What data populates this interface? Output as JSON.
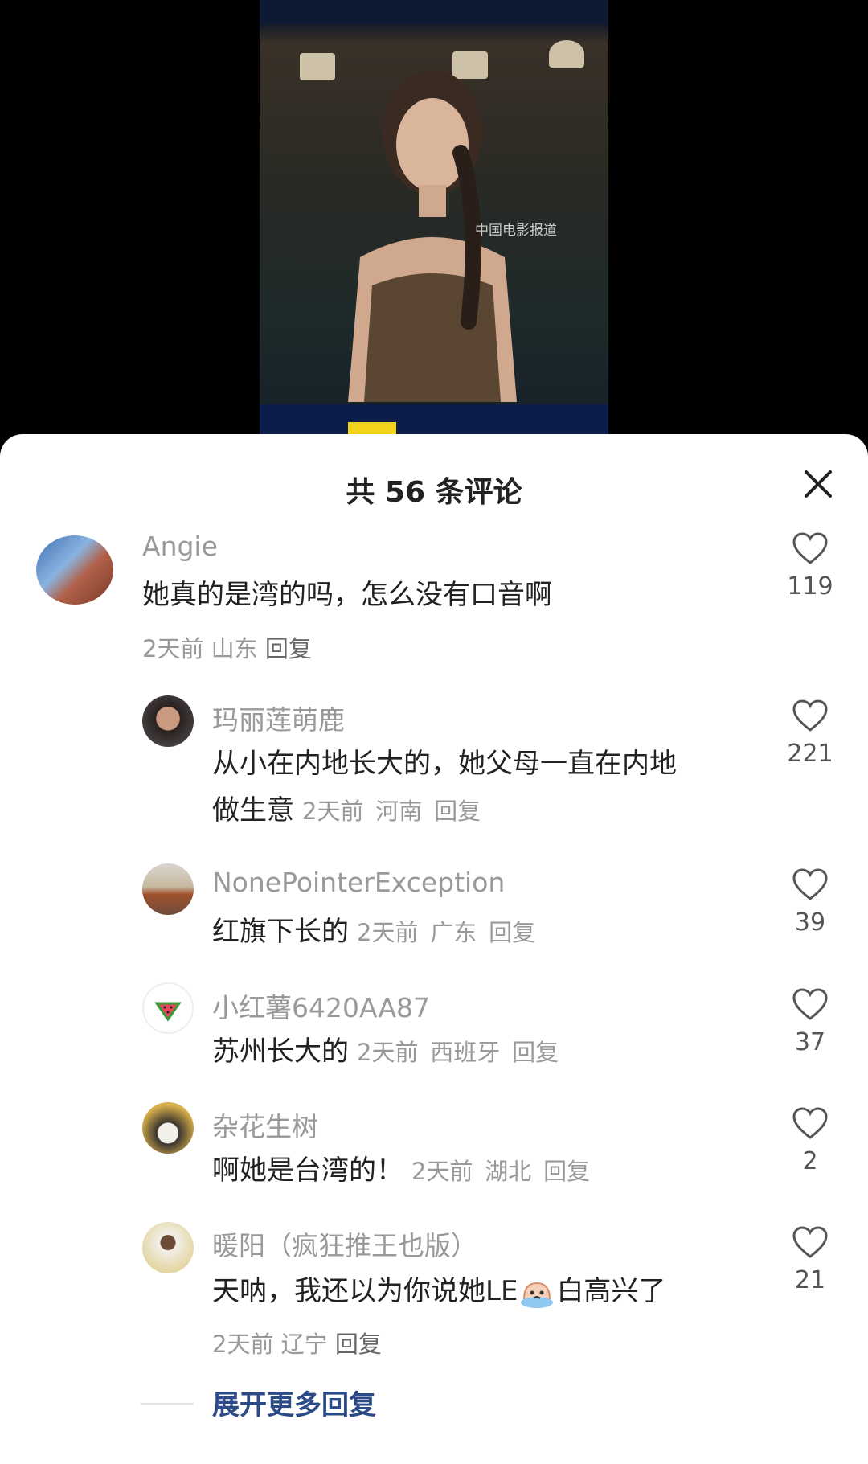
{
  "video": {
    "watermark": "中国电影报道"
  },
  "sheet": {
    "title": "共 56 条评论"
  },
  "comments": [
    {
      "user": "Angie",
      "text": "她真的是湾的吗，怎么没有口音啊",
      "time": "2天前",
      "region": "山东",
      "reply": "回复",
      "likes": "119"
    },
    {
      "user": "玛丽莲萌鹿",
      "text": "从小在内地长大的，她父母一直在内地",
      "text2": "做生意",
      "time": "2天前",
      "region": "河南",
      "reply": "回复",
      "likes": "221"
    },
    {
      "user": "NonePointerException",
      "text": "红旗下长的",
      "time": "2天前",
      "region": "广东",
      "reply": "回复",
      "likes": "39"
    },
    {
      "user": "小红薯6420AA87",
      "text": "苏州长大的",
      "time": "2天前",
      "region": "西班牙",
      "reply": "回复",
      "likes": "37"
    },
    {
      "user": "杂花生树",
      "text": "啊她是台湾的！",
      "time": "2天前",
      "region": "湖北",
      "reply": "回复",
      "likes": "2"
    },
    {
      "user": "暖阳（疯狂推王也版）",
      "text": "天呐，我还以为你说她LE",
      "text_after_emoji": "白高兴了",
      "time": "2天前",
      "region": "辽宁",
      "reply": "回复",
      "likes": "21"
    }
  ],
  "expand_label": "展开更多回复",
  "icons": {
    "close": "close-icon",
    "like": "heart-outline-icon",
    "emoji": "crying-emoji-icon"
  }
}
